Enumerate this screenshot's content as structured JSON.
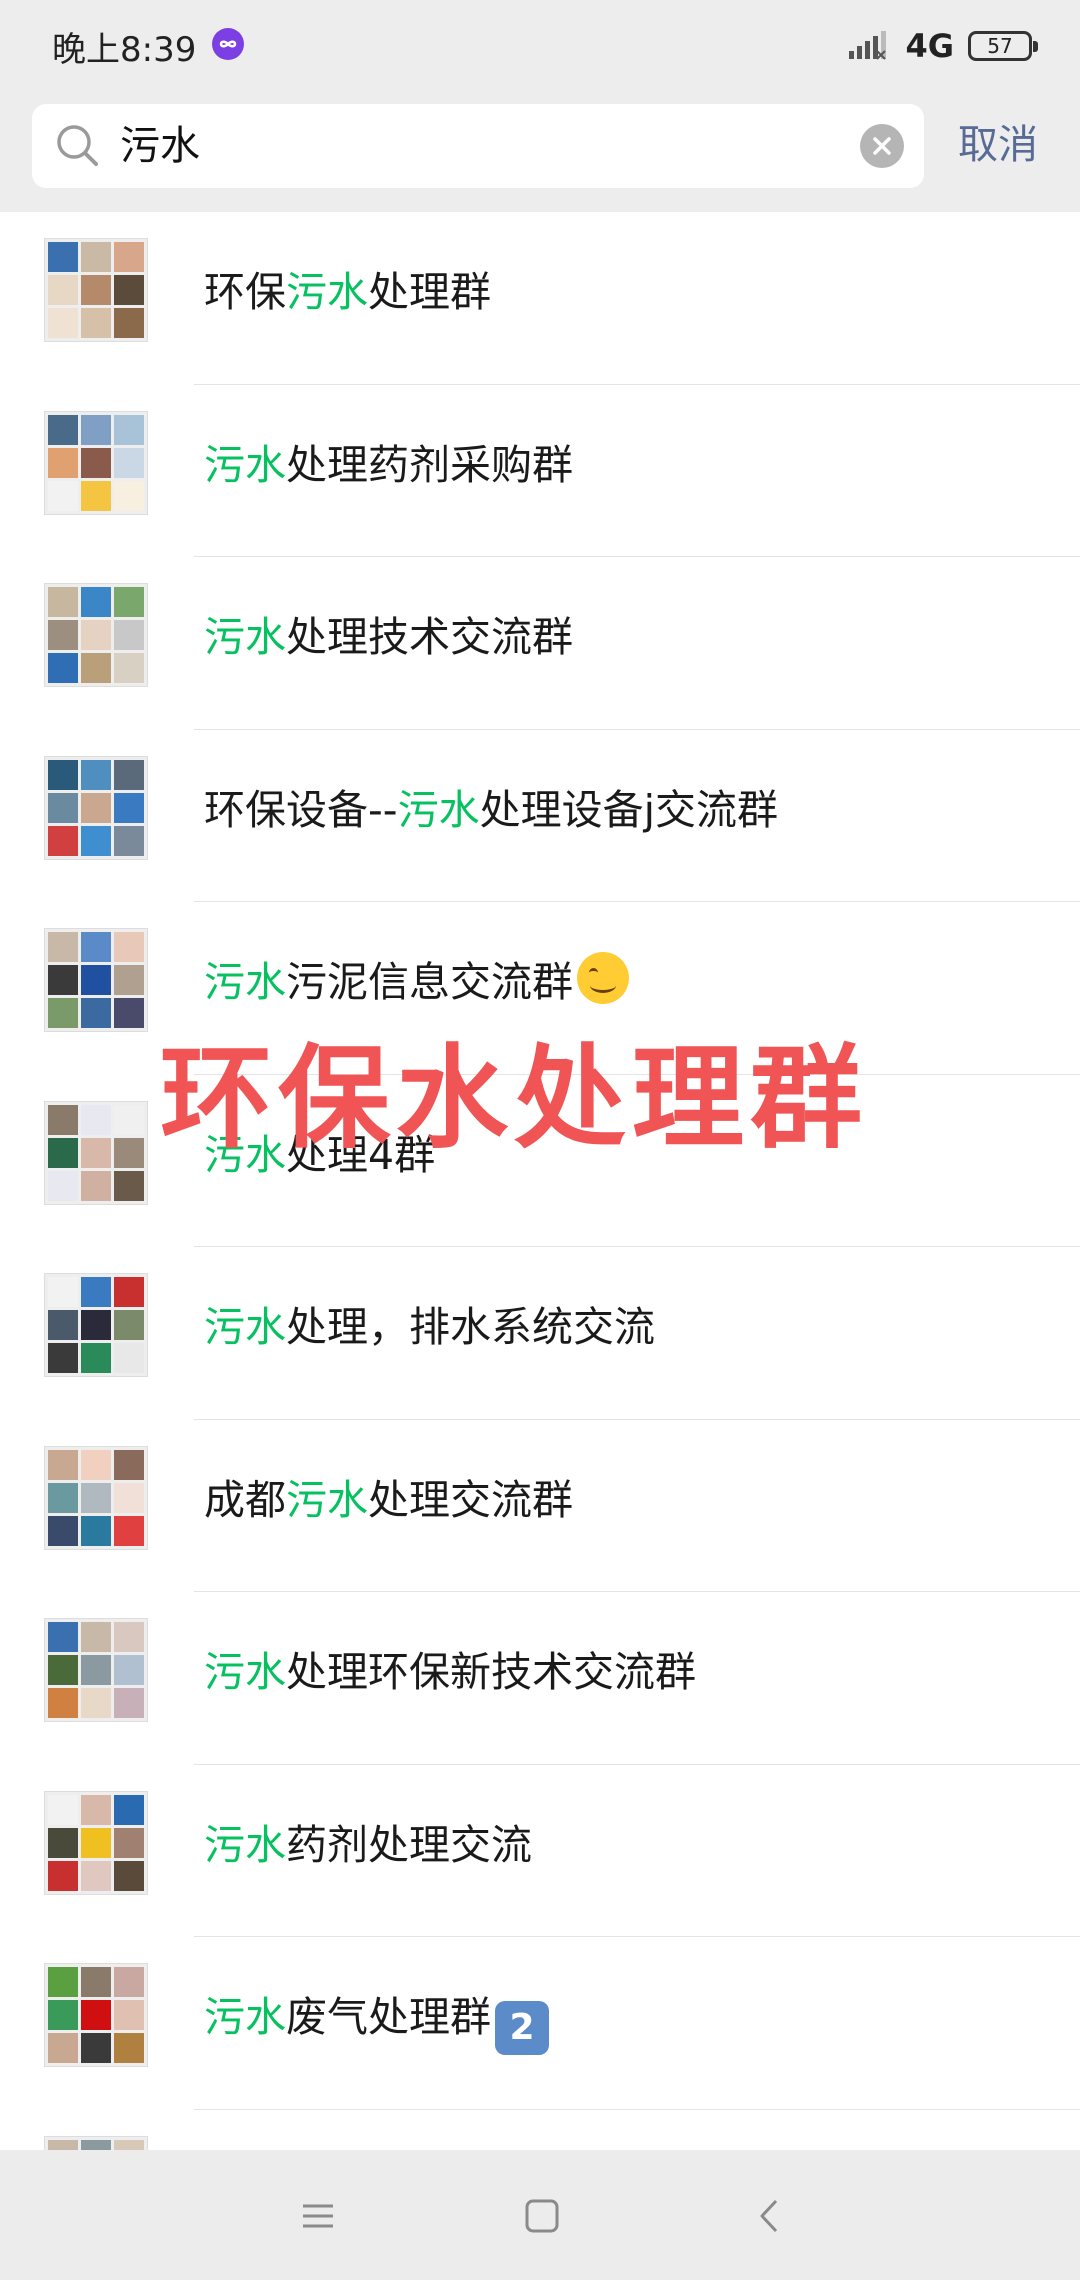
{
  "status_bar": {
    "time": "晚上8:39",
    "app_icon": "infinity-app-icon",
    "network": "4G",
    "battery": "57"
  },
  "search": {
    "query": "污水",
    "cancel_label": "取消"
  },
  "results": [
    {
      "prefix": "环保",
      "highlight": "污水",
      "suffix": "处理群"
    },
    {
      "prefix": "",
      "highlight": "污水",
      "suffix": "处理药剂采购群"
    },
    {
      "prefix": "",
      "highlight": "污水",
      "suffix": "处理技术交流群"
    },
    {
      "prefix": "环保设备--",
      "highlight": "污水",
      "suffix": "处理设备j交流群"
    },
    {
      "prefix": "",
      "highlight": "污水",
      "suffix": "污泥信息交流群",
      "emoji": "smiling-face-emoji"
    },
    {
      "prefix": "",
      "highlight": "污水",
      "suffix": "处理4群"
    },
    {
      "prefix": "",
      "highlight": "污水",
      "suffix": "处理，排水系统交流"
    },
    {
      "prefix": "成都",
      "highlight": "污水",
      "suffix": "处理交流群"
    },
    {
      "prefix": "",
      "highlight": "污水",
      "suffix": "处理环保新技术交流群"
    },
    {
      "prefix": "",
      "highlight": "污水",
      "suffix": "药剂处理交流"
    },
    {
      "prefix": "",
      "highlight": "污水",
      "suffix": "废气处理群",
      "emoji_keycap": "2"
    }
  ],
  "overlay_text": "环保水处理群",
  "colors": {
    "highlight": "#07c160",
    "cancel": "#576b95",
    "overlay": "#f05454"
  }
}
